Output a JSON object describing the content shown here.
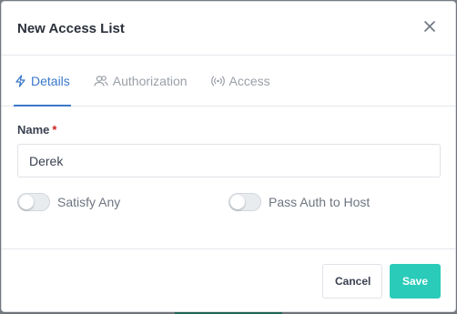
{
  "modal": {
    "title": "New Access List",
    "close_icon": "close-icon"
  },
  "tabs": [
    {
      "label": "Details",
      "icon": "lightning-icon",
      "active": true
    },
    {
      "label": "Authorization",
      "icon": "users-icon",
      "active": false
    },
    {
      "label": "Access",
      "icon": "radio-waves-icon",
      "active": false
    }
  ],
  "form": {
    "name_label": "Name",
    "name_required_mark": "*",
    "name_value": "Derek",
    "satisfy_any_label": "Satisfy Any",
    "satisfy_any_on": false,
    "pass_auth_label": "Pass Auth to Host",
    "pass_auth_on": false
  },
  "footer": {
    "cancel_label": "Cancel",
    "save_label": "Save"
  },
  "colors": {
    "accent": "#3a78c9",
    "save": "#2bcbba",
    "required": "#cd201f"
  }
}
